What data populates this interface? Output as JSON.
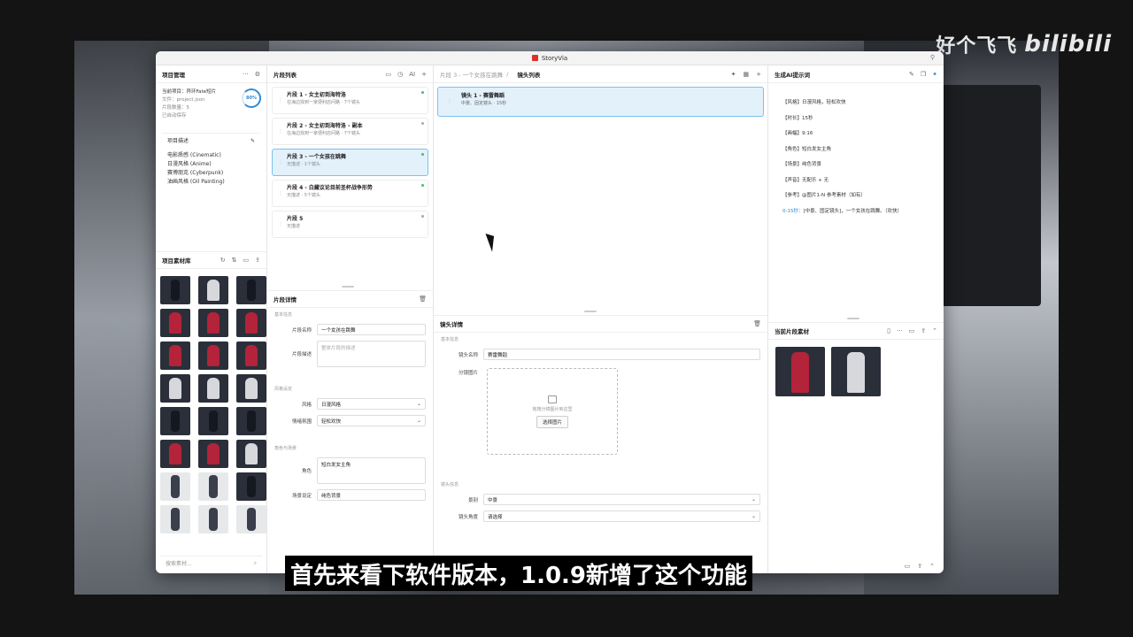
{
  "watermark": {
    "channel": "好个飞飞",
    "brand": "bilibili"
  },
  "window": {
    "title": "StoryVia"
  },
  "project": {
    "header": "项目管理",
    "current": "当前项目：异环Fate短片",
    "file": "文件：project.json",
    "segments_count": "片段数量：5",
    "autosave": "已自动保存",
    "progress": "80%",
    "progress_value": 0.8,
    "desc_header": "项目描述",
    "styles": [
      "电影质感 (Cinematic)",
      "日漫风格 (Anime)",
      "赛博朋克 (Cyberpunk)",
      "油画风格 (Oil Painting)"
    ]
  },
  "assets": {
    "header": "项目素材库",
    "thumbs": [
      "dark",
      "silver",
      "dark",
      "red",
      "red",
      "red",
      "red",
      "red",
      "red",
      "silver",
      "silver",
      "silver",
      "dark",
      "dark",
      "dark",
      "red",
      "red",
      "silver",
      "light",
      "light",
      "dark",
      "light",
      "light",
      "light"
    ],
    "search_placeholder": "搜索素材..."
  },
  "segments": {
    "header": "片段列表",
    "ai_label": "AI",
    "items": [
      {
        "title": "片段 1 - 女主初到海特洛",
        "sub": "在海边找到一家便利店问路 · 7个镜头",
        "dot": "green"
      },
      {
        "title": "片段 2 - 女主初到海特洛 - 副本",
        "sub": "在海边找到一家便利店问路 · 7个镜头",
        "dot": "grey"
      },
      {
        "title": "片段 3 - 一个女孩在跳舞",
        "sub": "无描述 · 1个镜头",
        "dot": "green"
      },
      {
        "title": "片段 4 - 白藏议论目前圣杯战争形势",
        "sub": "无描述 · 5个镜头",
        "dot": "green"
      },
      {
        "title": "片段 5",
        "sub": "无描述",
        "dot": "grey"
      }
    ]
  },
  "segment_detail": {
    "header": "片段详情",
    "basic": "基本信息",
    "name_label": "片段名称",
    "name_value": "一个女孩在跳舞",
    "desc_label": "片段描述",
    "desc_placeholder": "整体片段的描述",
    "style_section": "风格设定",
    "style_label": "风格",
    "style_value": "日漫风格",
    "mood_label": "情绪氛围",
    "mood_value": "轻松欢快",
    "char_section": "角色与场景",
    "role_label": "角色",
    "role_value": "短白发女主角",
    "scene_label": "场景设定",
    "scene_value": "纯色背景"
  },
  "shots": {
    "crumb_parent": "片段 3 - 一个女孩在跳舞",
    "crumb_current": "镜头列表",
    "items": [
      {
        "title": "镜头 1 - 赛雷舞蹈",
        "sub": "中景、固定镜头 · 15秒"
      }
    ]
  },
  "shot_detail": {
    "header": "镜头详情",
    "basic": "基本信息",
    "name_label": "镜头名称",
    "name_value": "赛雷舞蹈",
    "image_label": "分镜图片",
    "upload_hint": "拖拽分镜图片到这里",
    "upload_btn": "选择图片",
    "info_section": "镜头信息",
    "scale_label": "景别",
    "scale_value": "中景",
    "angle_label": "镜头角度",
    "angle_value": "请选择"
  },
  "prompt": {
    "header": "生成AI提示词",
    "lines": [
      "【风格】日漫风格，轻松欢快",
      "【时长】15秒",
      "【画幅】9:16",
      "【角色】短白发女主角",
      "【场景】纯色背景",
      "【声音】无配乐 + 无",
      "【参考】@图片1-N 参考素材（如有）"
    ],
    "time_tag": "0-15秒：",
    "time_text": "[中景、固定镜头]，一个女孩在跳舞。（欢快）"
  },
  "current_assets": {
    "header": "当前片段素材",
    "thumbs": [
      "red",
      "silver"
    ]
  },
  "subtitle": "首先来看下软件版本，1.0.9新增了这个功能"
}
